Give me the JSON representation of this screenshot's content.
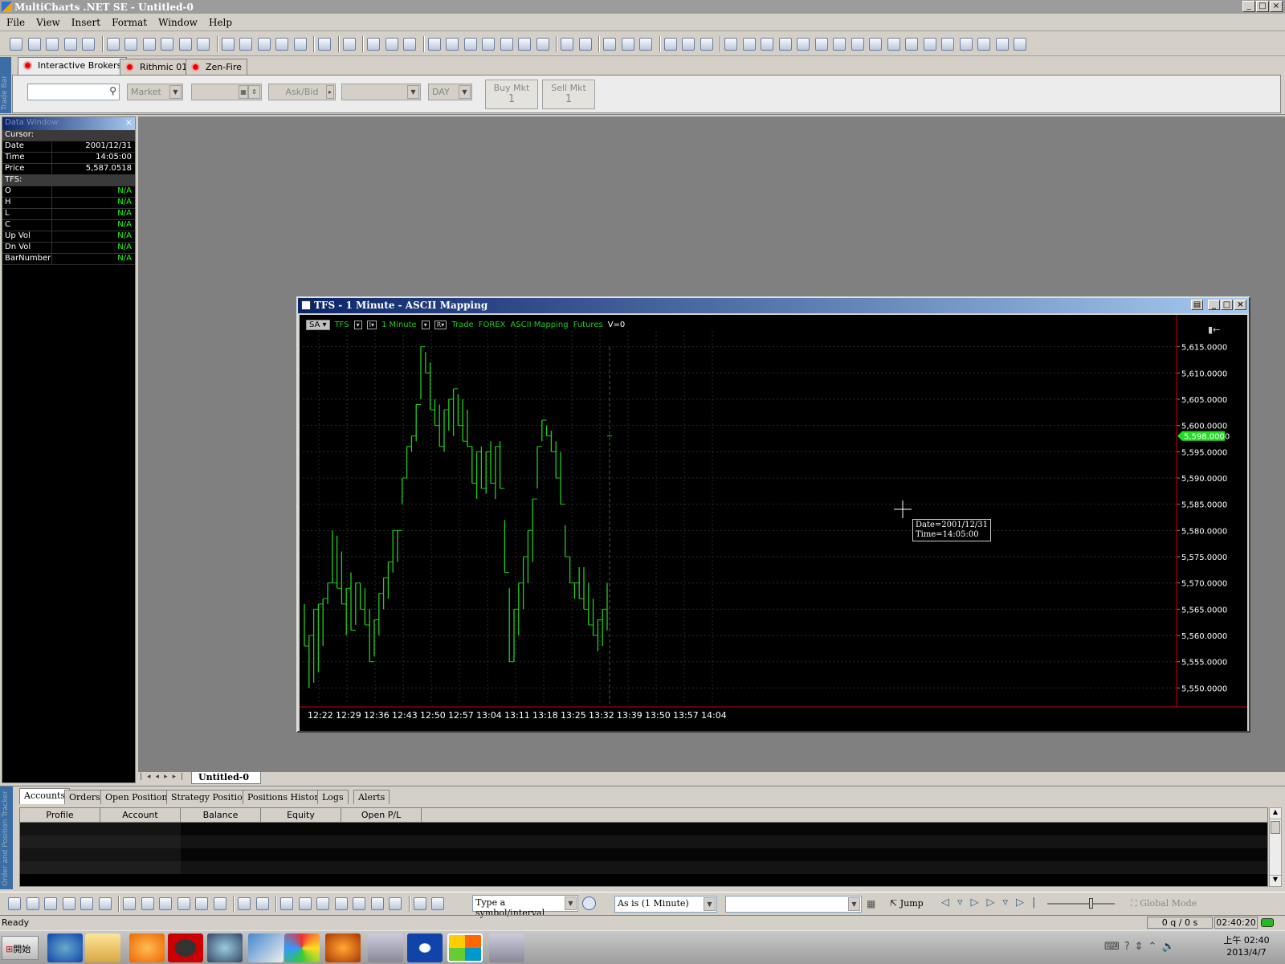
{
  "window": {
    "title": "MultiCharts .NET SE - Untitled-0"
  },
  "menu": [
    "File",
    "View",
    "Insert",
    "Format",
    "Window",
    "Help"
  ],
  "trade_bar": {
    "side_label": "Trade Bar",
    "tabs": [
      "Interactive Brokers",
      "Rithmic 01",
      "Zen-Fire"
    ],
    "order_type": "Market",
    "price_source": "Ask/Bid",
    "duration": "DAY",
    "buy_label": "Buy Mkt",
    "buy_qty": "1",
    "sell_label": "Sell Mkt",
    "sell_qty": "1"
  },
  "data_window": {
    "title": "Data Window",
    "cursor_header": "Cursor:",
    "cursor_rows": [
      {
        "k": "Date",
        "v": "2001/12/31"
      },
      {
        "k": "Time",
        "v": "14:05:00"
      },
      {
        "k": "Price",
        "v": "5,587.0518"
      }
    ],
    "tfs_header": "TFS:",
    "tfs_rows": [
      {
        "k": "O",
        "v": "N/A"
      },
      {
        "k": "H",
        "v": "N/A"
      },
      {
        "k": "L",
        "v": "N/A"
      },
      {
        "k": "C",
        "v": "N/A"
      },
      {
        "k": "Up Vol",
        "v": "N/A"
      },
      {
        "k": "Dn Vol",
        "v": "N/A"
      },
      {
        "k": "BarNumber",
        "v": "N/A"
      }
    ]
  },
  "chart_window": {
    "title": "TFS - 1 Minute - ASCII Mapping",
    "header": {
      "mode": "SA",
      "symbol": "TFS",
      "interval": "1 Minute",
      "data_type": "Trade",
      "category": "FOREX",
      "source": "ASCII Mapping",
      "kind": "Futures",
      "volume": "V=0"
    },
    "tooltip": {
      "date": "Date=2001/12/31",
      "time": "Time=14:05:00"
    },
    "last_price": "5,598.0000"
  },
  "chart_data": {
    "type": "line",
    "x_tick_labels": [
      "12:22",
      "12:29",
      "12:36",
      "12:43",
      "12:50",
      "12:57",
      "13:04",
      "13:11",
      "13:18",
      "13:25",
      "13:32",
      "13:39",
      "13:50",
      "13:57",
      "14:04"
    ],
    "y_tick_labels": [
      "5,615.0000",
      "5,610.0000",
      "5,605.0000",
      "5,600.0000",
      "5,595.0000",
      "5,590.0000",
      "5,585.0000",
      "5,580.0000",
      "5,575.0000",
      "5,570.0000",
      "5,565.0000",
      "5,560.0000",
      "5,555.0000",
      "5,550.0000"
    ],
    "ylim": [
      5547,
      5618
    ],
    "last_price": 5598,
    "series": [
      {
        "color": "#22cc22",
        "bars": [
          [
            5558,
            5566
          ],
          [
            5550,
            5560
          ],
          [
            5551,
            5565
          ],
          [
            5553,
            5566
          ],
          [
            5558,
            5567
          ],
          [
            5566,
            5570
          ],
          [
            5570,
            5580
          ],
          [
            5569,
            5579
          ],
          [
            5566,
            5576
          ],
          [
            5560,
            5569
          ],
          [
            5561,
            5572
          ],
          [
            5562,
            5570
          ],
          [
            5565,
            5570
          ],
          [
            5562,
            5569
          ],
          [
            5555,
            5565
          ],
          [
            5556,
            5563
          ],
          [
            5560,
            5568
          ],
          [
            5565,
            5571
          ],
          [
            5567,
            5574
          ],
          [
            5572,
            5580
          ],
          [
            5574,
            5580
          ],
          [
            5585,
            5590
          ],
          [
            5590,
            5596
          ],
          [
            5595,
            5598
          ],
          [
            5597,
            5604
          ],
          [
            5605,
            5615
          ],
          [
            5610,
            5614
          ],
          [
            5603,
            5612
          ],
          [
            5600,
            5605
          ],
          [
            5596,
            5604
          ],
          [
            5595,
            5603
          ],
          [
            5599,
            5605
          ],
          [
            5598,
            5607
          ],
          [
            5600,
            5606
          ],
          [
            5597,
            5605
          ],
          [
            5596,
            5603
          ],
          [
            5589,
            5596
          ],
          [
            5586,
            5595
          ],
          [
            5588,
            5596
          ],
          [
            5587,
            5595
          ],
          [
            5589,
            5597
          ],
          [
            5586,
            5596
          ],
          [
            5588,
            5597
          ],
          [
            5572,
            5582
          ],
          [
            5555,
            5569
          ],
          [
            5555,
            5565
          ],
          [
            5560,
            5570
          ],
          [
            5565,
            5575
          ],
          [
            5570,
            5580
          ],
          [
            5574,
            5586
          ],
          [
            5588,
            5596
          ],
          [
            5597,
            5601
          ],
          [
            5598,
            5600
          ],
          [
            5595,
            5599
          ],
          [
            5590,
            5597
          ],
          [
            5585,
            5595
          ],
          [
            5575,
            5581
          ],
          [
            5570,
            5575
          ],
          [
            5567,
            5570
          ],
          [
            5567,
            5573
          ],
          [
            5565,
            5573
          ],
          [
            5562,
            5570
          ],
          [
            5560,
            5567
          ],
          [
            5557,
            5563
          ],
          [
            5558,
            5565
          ],
          [
            5561,
            5570
          ]
        ]
      }
    ]
  },
  "sheet_tab": "Untitled-0",
  "orders_panel": {
    "side_label": "Order and Position Tracker",
    "tabs": [
      "Accounts",
      "Orders",
      "Open Positions",
      "Strategy Positions",
      "Positions History",
      "Logs",
      "Alerts"
    ],
    "columns": [
      "Profile",
      "Account",
      "Balance",
      "Equity",
      "Open P/L"
    ]
  },
  "bottom_toolbar": {
    "symbol_placeholder": "Type a symbol/interval",
    "resolution": "As is (1 Minute)",
    "jump_label": "Jump",
    "global_mode": "Global Mode",
    "queue": "0 q / 0 s",
    "clock": "02:40:20"
  },
  "status": {
    "text": "Ready"
  },
  "taskbar": {
    "start": "開始",
    "time": "上午 02:40",
    "date": "2013/4/7"
  }
}
